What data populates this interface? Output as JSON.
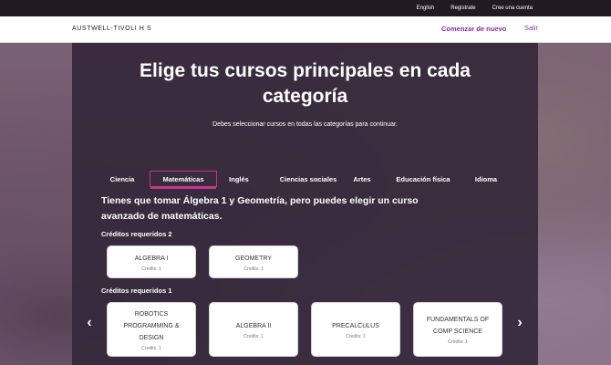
{
  "topbar": {
    "links": [
      "English",
      "Registrate",
      "Cree una cuenta"
    ]
  },
  "header": {
    "logo": "AUSTWELL-TIVOLI H S",
    "start_label": "Comenzar de nuevo",
    "exit_label": "Salir"
  },
  "main": {
    "title_line1": "Elige tus cursos principales en cada",
    "title_line2": "categoría",
    "subtitle": "Debes seleccionar cursos en todas las categorías para continuar.",
    "tabs": [
      {
        "label": "Ciencia"
      },
      {
        "label": "Matemáticas",
        "active": true
      },
      {
        "label": "Inglés"
      },
      {
        "label": "Ciencias sociales"
      },
      {
        "label": "Artes"
      },
      {
        "label": "Educación física"
      },
      {
        "label": "Idioma"
      }
    ],
    "instructions_line1": "Tienes que tomar Álgebra 1 y Geometría, pero puedes elegir un curso",
    "instructions_line2": "avanzado de matemáticas.",
    "required_group_1": "Créditos requeridos 2",
    "required_group_2": "Créditos requeridos 1",
    "group1_courses": [
      {
        "name": "ALGEBRA I",
        "credits": "Credits: 1"
      },
      {
        "name": "GEOMETRY",
        "credits": "Credits: 1"
      }
    ],
    "group2_courses": [
      {
        "name_line1": "ROBOTICS",
        "name_line2": "PROGRAMMING &",
        "name_line3": "DESIGN",
        "credits": "Credits: 1"
      },
      {
        "name_line1": "ALGEBRA II",
        "credits": "Credits: 1"
      },
      {
        "name_line1": "PRECALCULUS",
        "credits": "Credits: 1"
      },
      {
        "name_line1": "FUNDAMENTALS OF",
        "name_line2": "COMP SCIENCE",
        "credits": "Credits: 1"
      }
    ],
    "prev_arrow": "‹",
    "next_arrow": "›"
  },
  "colors": {
    "accent": "#8c2f9c",
    "tab_active_border": "#c2378f",
    "panel": "#34283a"
  }
}
